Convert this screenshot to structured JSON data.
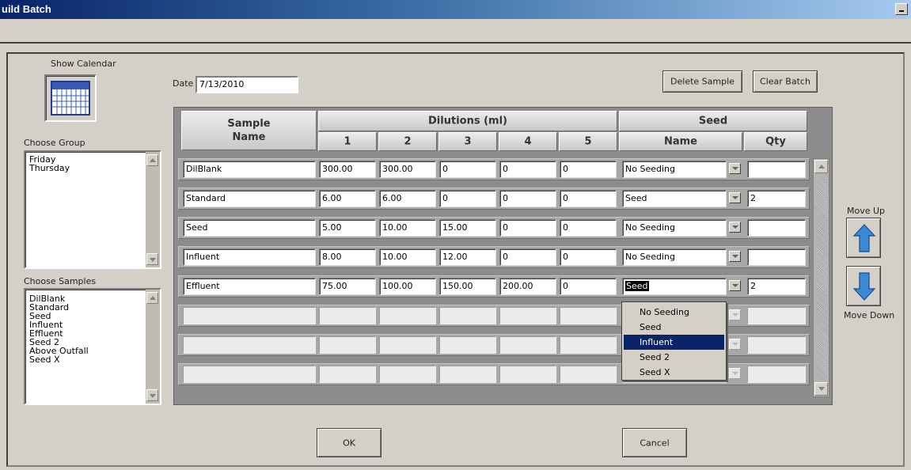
{
  "window": {
    "title": "uild Batch"
  },
  "calendar": {
    "label": "Show Calendar",
    "icon": "calendar-icon"
  },
  "date": {
    "label": "Date",
    "value": "7/13/2010"
  },
  "buttons": {
    "delete_sample": "Delete Sample",
    "clear_batch": "Clear Batch",
    "ok": "OK",
    "cancel": "Cancel",
    "move_up": "Move Up",
    "move_down": "Move Down"
  },
  "groups": {
    "label": "Choose Group",
    "items": [
      "Friday",
      "Thursday"
    ]
  },
  "samples": {
    "label": "Choose Samples",
    "items": [
      "DilBlank",
      "Standard",
      "Seed",
      "Influent",
      "Effluent",
      "Seed 2",
      "Above Outfall",
      "Seed X"
    ]
  },
  "table": {
    "header_sample_line1": "Sample",
    "header_sample_line2": "Name",
    "header_dilutions": "Dilutions (ml)",
    "dilution_cols": [
      "1",
      "2",
      "3",
      "4",
      "5"
    ],
    "header_seed": "Seed",
    "seed_name": "Name",
    "seed_qty": "Qty",
    "rows": [
      {
        "name": "DilBlank",
        "d": [
          "300.00",
          "300.00",
          "0",
          "0",
          "0"
        ],
        "seed": "No Seeding",
        "qty": ""
      },
      {
        "name": "Standard",
        "d": [
          "6.00",
          "6.00",
          "0",
          "0",
          "0"
        ],
        "seed": "Seed",
        "qty": "2"
      },
      {
        "name": "Seed",
        "d": [
          "5.00",
          "10.00",
          "15.00",
          "0",
          "0"
        ],
        "seed": "No Seeding",
        "qty": ""
      },
      {
        "name": "Influent",
        "d": [
          "8.00",
          "10.00",
          "12.00",
          "0",
          "0"
        ],
        "seed": "No Seeding",
        "qty": ""
      },
      {
        "name": "Effluent",
        "d": [
          "75.00",
          "100.00",
          "150.00",
          "200.00",
          "0"
        ],
        "seed": "Seed",
        "qty": "2"
      }
    ],
    "empty_rows": 3
  },
  "seed_dropdown": {
    "options": [
      "No Seeding",
      "Seed",
      "Influent",
      "Seed 2",
      "Seed X"
    ],
    "highlighted": "Influent"
  },
  "colors": {
    "highlight": "#0a246a",
    "arrow": "#3b8ad8",
    "background": "#d4d0c8"
  }
}
